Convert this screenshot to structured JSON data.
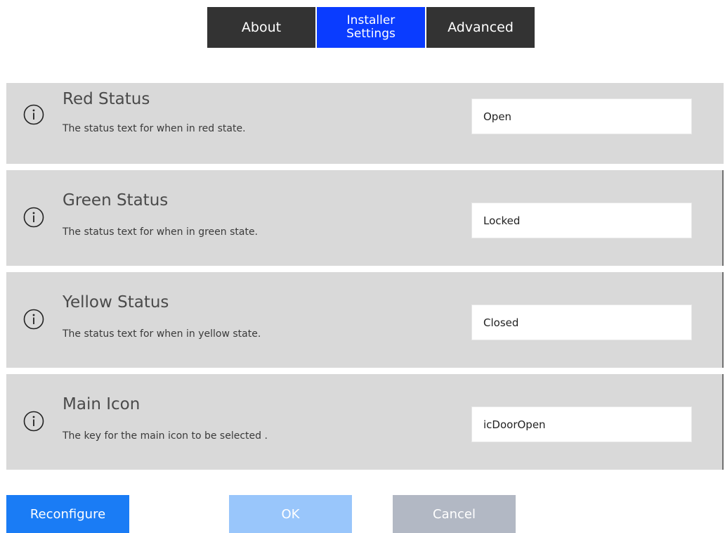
{
  "tabs": [
    {
      "label": "About"
    },
    {
      "label": "Installer\nSettings",
      "active": true
    },
    {
      "label": "Advanced"
    }
  ],
  "settings": [
    {
      "title": "Red Status",
      "description": "The status text for when in red state.",
      "value": "Open"
    },
    {
      "title": "Green Status",
      "description": "The status text for when in green state.",
      "value": "Locked"
    },
    {
      "title": "Yellow Status",
      "description": "The status text for when in yellow state.",
      "value": "Closed"
    },
    {
      "title": "Main Icon",
      "description": "The key for the main icon to be selected .",
      "value": "icDoorOpen"
    }
  ],
  "buttons": {
    "reconfigure": "Reconfigure",
    "ok": "OK",
    "cancel": "Cancel"
  },
  "icons": {
    "info": "info-icon"
  },
  "colors": {
    "tab_dark": "#333333",
    "tab_active": "#0a3cff",
    "row_bg": "#d9d9d9",
    "primary": "#1a7cf5",
    "primary_disabled": "#99c6fb",
    "cancel_disabled": "#b2b8c4"
  }
}
